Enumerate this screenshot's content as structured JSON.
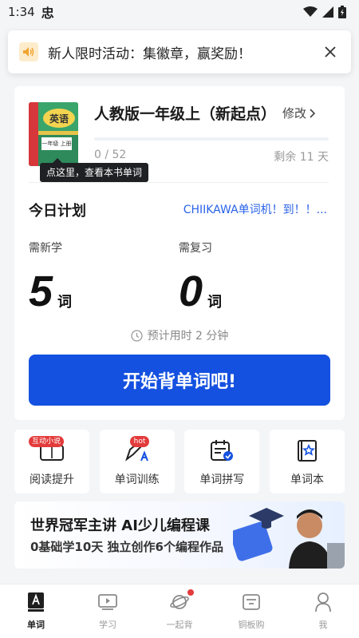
{
  "status_bar": {
    "time": "1:34",
    "app_glyph": "忠"
  },
  "banner": {
    "text": "新人限时活动：集徽章，赢奖励！",
    "icon": "speaker-icon",
    "close_icon": "close-icon"
  },
  "book": {
    "cover_subject": "英语",
    "cover_grade": "一年级 上册",
    "title": "人教版一年级上（新起点）",
    "modify_label": "修改",
    "progress_text": "0 / 52",
    "progress_fraction": 0,
    "remaining_text": "剩余 11 天",
    "tooltip": "点这里，查看本书单词"
  },
  "plan": {
    "title": "今日计划",
    "link_text": "CHIIKAWA单词机！到！！...",
    "new_label": "需新学",
    "new_count": "5",
    "new_unit": "词",
    "review_label": "需复习",
    "review_count": "0",
    "review_unit": "词",
    "estimate": "预计用时 2 分钟",
    "start_button": "开始背单词吧!"
  },
  "features": [
    {
      "label": "阅读提升",
      "badge": "互动小说",
      "icon": "book-reading-icon"
    },
    {
      "label": "单词训练",
      "badge": "hot",
      "icon": "pen-training-icon"
    },
    {
      "label": "单词拼写",
      "badge": "",
      "icon": "calendar-check-icon"
    },
    {
      "label": "单词本",
      "badge": "",
      "icon": "notebook-star-icon"
    }
  ],
  "promo": {
    "title": "世界冠军主讲  AI少儿编程课",
    "subtitle": "0基础学10天  独立创作6个编程作品"
  },
  "nav": [
    {
      "label": "单词",
      "icon": "word-book-icon",
      "active": true
    },
    {
      "label": "学习",
      "icon": "video-play-icon",
      "active": false
    },
    {
      "label": "一起背",
      "icon": "planet-icon",
      "active": false,
      "dot": true
    },
    {
      "label": "铜板购",
      "icon": "shop-icon",
      "active": false
    },
    {
      "label": "我",
      "icon": "person-icon",
      "active": false
    }
  ],
  "colors": {
    "accent": "#1451e0",
    "link": "#2a63e8",
    "badge_red": "#e33b3b"
  }
}
